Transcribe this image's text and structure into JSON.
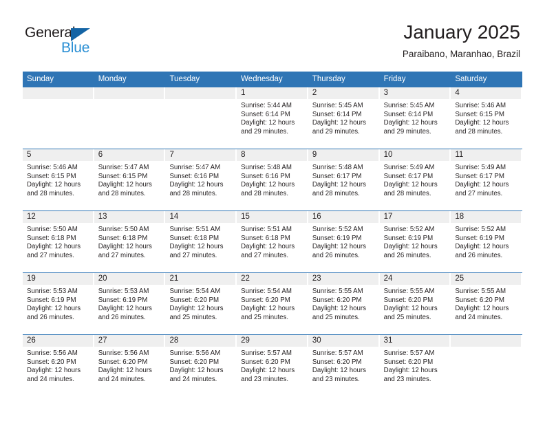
{
  "brand": {
    "name_part1": "General",
    "name_part2": "Blue",
    "triangle_icon": "triangle-icon",
    "color_dark": "#231f20",
    "color_blue": "#2a8fd4"
  },
  "header": {
    "month_title": "January 2025",
    "location": "Paraibano, Maranhao, Brazil"
  },
  "theme": {
    "header_band": "#2f75b5",
    "day_band": "#efefef",
    "text": "#231f20",
    "page_background": "#ffffff"
  },
  "weekdays": [
    "Sunday",
    "Monday",
    "Tuesday",
    "Wednesday",
    "Thursday",
    "Friday",
    "Saturday"
  ],
  "labels": {
    "sunrise_prefix": "Sunrise:",
    "sunset_prefix": "Sunset:",
    "daylight_prefix": "Daylight:"
  },
  "weeks": [
    [
      {
        "day": "",
        "empty": true
      },
      {
        "day": "",
        "empty": true
      },
      {
        "day": "",
        "empty": true
      },
      {
        "day": "1",
        "sunrise": "Sunrise: 5:44 AM",
        "sunset": "Sunset: 6:14 PM",
        "daylight_line1": "Daylight: 12 hours",
        "daylight_line2": "and 29 minutes."
      },
      {
        "day": "2",
        "sunrise": "Sunrise: 5:45 AM",
        "sunset": "Sunset: 6:14 PM",
        "daylight_line1": "Daylight: 12 hours",
        "daylight_line2": "and 29 minutes."
      },
      {
        "day": "3",
        "sunrise": "Sunrise: 5:45 AM",
        "sunset": "Sunset: 6:14 PM",
        "daylight_line1": "Daylight: 12 hours",
        "daylight_line2": "and 29 minutes."
      },
      {
        "day": "4",
        "sunrise": "Sunrise: 5:46 AM",
        "sunset": "Sunset: 6:15 PM",
        "daylight_line1": "Daylight: 12 hours",
        "daylight_line2": "and 28 minutes."
      }
    ],
    [
      {
        "day": "5",
        "sunrise": "Sunrise: 5:46 AM",
        "sunset": "Sunset: 6:15 PM",
        "daylight_line1": "Daylight: 12 hours",
        "daylight_line2": "and 28 minutes."
      },
      {
        "day": "6",
        "sunrise": "Sunrise: 5:47 AM",
        "sunset": "Sunset: 6:15 PM",
        "daylight_line1": "Daylight: 12 hours",
        "daylight_line2": "and 28 minutes."
      },
      {
        "day": "7",
        "sunrise": "Sunrise: 5:47 AM",
        "sunset": "Sunset: 6:16 PM",
        "daylight_line1": "Daylight: 12 hours",
        "daylight_line2": "and 28 minutes."
      },
      {
        "day": "8",
        "sunrise": "Sunrise: 5:48 AM",
        "sunset": "Sunset: 6:16 PM",
        "daylight_line1": "Daylight: 12 hours",
        "daylight_line2": "and 28 minutes."
      },
      {
        "day": "9",
        "sunrise": "Sunrise: 5:48 AM",
        "sunset": "Sunset: 6:17 PM",
        "daylight_line1": "Daylight: 12 hours",
        "daylight_line2": "and 28 minutes."
      },
      {
        "day": "10",
        "sunrise": "Sunrise: 5:49 AM",
        "sunset": "Sunset: 6:17 PM",
        "daylight_line1": "Daylight: 12 hours",
        "daylight_line2": "and 28 minutes."
      },
      {
        "day": "11",
        "sunrise": "Sunrise: 5:49 AM",
        "sunset": "Sunset: 6:17 PM",
        "daylight_line1": "Daylight: 12 hours",
        "daylight_line2": "and 27 minutes."
      }
    ],
    [
      {
        "day": "12",
        "sunrise": "Sunrise: 5:50 AM",
        "sunset": "Sunset: 6:18 PM",
        "daylight_line1": "Daylight: 12 hours",
        "daylight_line2": "and 27 minutes."
      },
      {
        "day": "13",
        "sunrise": "Sunrise: 5:50 AM",
        "sunset": "Sunset: 6:18 PM",
        "daylight_line1": "Daylight: 12 hours",
        "daylight_line2": "and 27 minutes."
      },
      {
        "day": "14",
        "sunrise": "Sunrise: 5:51 AM",
        "sunset": "Sunset: 6:18 PM",
        "daylight_line1": "Daylight: 12 hours",
        "daylight_line2": "and 27 minutes."
      },
      {
        "day": "15",
        "sunrise": "Sunrise: 5:51 AM",
        "sunset": "Sunset: 6:18 PM",
        "daylight_line1": "Daylight: 12 hours",
        "daylight_line2": "and 27 minutes."
      },
      {
        "day": "16",
        "sunrise": "Sunrise: 5:52 AM",
        "sunset": "Sunset: 6:19 PM",
        "daylight_line1": "Daylight: 12 hours",
        "daylight_line2": "and 26 minutes."
      },
      {
        "day": "17",
        "sunrise": "Sunrise: 5:52 AM",
        "sunset": "Sunset: 6:19 PM",
        "daylight_line1": "Daylight: 12 hours",
        "daylight_line2": "and 26 minutes."
      },
      {
        "day": "18",
        "sunrise": "Sunrise: 5:52 AM",
        "sunset": "Sunset: 6:19 PM",
        "daylight_line1": "Daylight: 12 hours",
        "daylight_line2": "and 26 minutes."
      }
    ],
    [
      {
        "day": "19",
        "sunrise": "Sunrise: 5:53 AM",
        "sunset": "Sunset: 6:19 PM",
        "daylight_line1": "Daylight: 12 hours",
        "daylight_line2": "and 26 minutes."
      },
      {
        "day": "20",
        "sunrise": "Sunrise: 5:53 AM",
        "sunset": "Sunset: 6:19 PM",
        "daylight_line1": "Daylight: 12 hours",
        "daylight_line2": "and 26 minutes."
      },
      {
        "day": "21",
        "sunrise": "Sunrise: 5:54 AM",
        "sunset": "Sunset: 6:20 PM",
        "daylight_line1": "Daylight: 12 hours",
        "daylight_line2": "and 25 minutes."
      },
      {
        "day": "22",
        "sunrise": "Sunrise: 5:54 AM",
        "sunset": "Sunset: 6:20 PM",
        "daylight_line1": "Daylight: 12 hours",
        "daylight_line2": "and 25 minutes."
      },
      {
        "day": "23",
        "sunrise": "Sunrise: 5:55 AM",
        "sunset": "Sunset: 6:20 PM",
        "daylight_line1": "Daylight: 12 hours",
        "daylight_line2": "and 25 minutes."
      },
      {
        "day": "24",
        "sunrise": "Sunrise: 5:55 AM",
        "sunset": "Sunset: 6:20 PM",
        "daylight_line1": "Daylight: 12 hours",
        "daylight_line2": "and 25 minutes."
      },
      {
        "day": "25",
        "sunrise": "Sunrise: 5:55 AM",
        "sunset": "Sunset: 6:20 PM",
        "daylight_line1": "Daylight: 12 hours",
        "daylight_line2": "and 24 minutes."
      }
    ],
    [
      {
        "day": "26",
        "sunrise": "Sunrise: 5:56 AM",
        "sunset": "Sunset: 6:20 PM",
        "daylight_line1": "Daylight: 12 hours",
        "daylight_line2": "and 24 minutes."
      },
      {
        "day": "27",
        "sunrise": "Sunrise: 5:56 AM",
        "sunset": "Sunset: 6:20 PM",
        "daylight_line1": "Daylight: 12 hours",
        "daylight_line2": "and 24 minutes."
      },
      {
        "day": "28",
        "sunrise": "Sunrise: 5:56 AM",
        "sunset": "Sunset: 6:20 PM",
        "daylight_line1": "Daylight: 12 hours",
        "daylight_line2": "and 24 minutes."
      },
      {
        "day": "29",
        "sunrise": "Sunrise: 5:57 AM",
        "sunset": "Sunset: 6:20 PM",
        "daylight_line1": "Daylight: 12 hours",
        "daylight_line2": "and 23 minutes."
      },
      {
        "day": "30",
        "sunrise": "Sunrise: 5:57 AM",
        "sunset": "Sunset: 6:20 PM",
        "daylight_line1": "Daylight: 12 hours",
        "daylight_line2": "and 23 minutes."
      },
      {
        "day": "31",
        "sunrise": "Sunrise: 5:57 AM",
        "sunset": "Sunset: 6:20 PM",
        "daylight_line1": "Daylight: 12 hours",
        "daylight_line2": "and 23 minutes."
      },
      {
        "day": "",
        "empty": true
      }
    ]
  ]
}
